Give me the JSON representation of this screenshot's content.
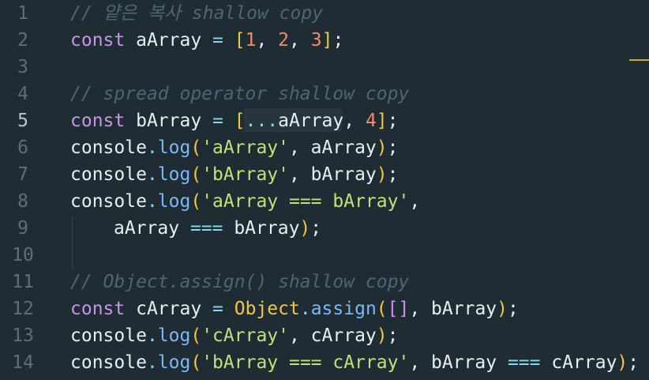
{
  "editor": {
    "active_line": 5,
    "lines": [
      {
        "no": "1",
        "tokens": [
          {
            "t": "// 얕은 복사 shallow copy",
            "c": "cmt"
          }
        ]
      },
      {
        "no": "2",
        "tokens": [
          {
            "t": "const",
            "c": "kw"
          },
          {
            "t": " aArray ",
            "c": "plain"
          },
          {
            "t": "=",
            "c": "op"
          },
          {
            "t": " ",
            "c": "plain"
          },
          {
            "t": "[",
            "c": "br"
          },
          {
            "t": "1",
            "c": "num"
          },
          {
            "t": ", ",
            "c": "plain"
          },
          {
            "t": "2",
            "c": "num"
          },
          {
            "t": ", ",
            "c": "plain"
          },
          {
            "t": "3",
            "c": "num"
          },
          {
            "t": "]",
            "c": "br"
          },
          {
            "t": ";",
            "c": "plain"
          }
        ]
      },
      {
        "no": "3",
        "tokens": []
      },
      {
        "no": "4",
        "tokens": [
          {
            "t": "// spread operator shallow copy",
            "c": "cmt"
          }
        ]
      },
      {
        "no": "5",
        "tokens": [
          {
            "t": "const",
            "c": "kw"
          },
          {
            "t": " bArray ",
            "c": "plain"
          },
          {
            "t": "=",
            "c": "op"
          },
          {
            "t": " ",
            "c": "plain"
          },
          {
            "t": "[",
            "c": "br"
          },
          {
            "t": "...",
            "c": "op"
          },
          {
            "t": "aArray, ",
            "c": "plain"
          },
          {
            "t": "4",
            "c": "num"
          },
          {
            "t": "]",
            "c": "br"
          },
          {
            "t": ";",
            "c": "plain"
          }
        ]
      },
      {
        "no": "6",
        "tokens": [
          {
            "t": "console",
            "c": "plain"
          },
          {
            "t": ".",
            "c": "op"
          },
          {
            "t": "log",
            "c": "fn"
          },
          {
            "t": "(",
            "c": "br"
          },
          {
            "t": "'aArray'",
            "c": "str"
          },
          {
            "t": ", aArray",
            "c": "plain"
          },
          {
            "t": ")",
            "c": "br"
          },
          {
            "t": ";",
            "c": "plain"
          }
        ]
      },
      {
        "no": "7",
        "tokens": [
          {
            "t": "console",
            "c": "plain"
          },
          {
            "t": ".",
            "c": "op"
          },
          {
            "t": "log",
            "c": "fn"
          },
          {
            "t": "(",
            "c": "br"
          },
          {
            "t": "'bArray'",
            "c": "str"
          },
          {
            "t": ", bArray",
            "c": "plain"
          },
          {
            "t": ")",
            "c": "br"
          },
          {
            "t": ";",
            "c": "plain"
          }
        ]
      },
      {
        "no": "8",
        "tokens": [
          {
            "t": "console",
            "c": "plain"
          },
          {
            "t": ".",
            "c": "op"
          },
          {
            "t": "log",
            "c": "fn"
          },
          {
            "t": "(",
            "c": "br"
          },
          {
            "t": "'aArray === bArray'",
            "c": "str"
          },
          {
            "t": ",",
            "c": "plain"
          }
        ]
      },
      {
        "no": "9",
        "indent": true,
        "tokens": [
          {
            "t": "aArray ",
            "c": "plain"
          },
          {
            "t": "===",
            "c": "op"
          },
          {
            "t": " bArray",
            "c": "plain"
          },
          {
            "t": ")",
            "c": "br"
          },
          {
            "t": ";",
            "c": "plain"
          }
        ]
      },
      {
        "no": "10",
        "tokens": []
      },
      {
        "no": "11",
        "tokens": [
          {
            "t": "// Object.assign() shallow copy",
            "c": "cmt"
          }
        ]
      },
      {
        "no": "12",
        "tokens": [
          {
            "t": "const",
            "c": "kw"
          },
          {
            "t": " cArray ",
            "c": "plain"
          },
          {
            "t": "=",
            "c": "op"
          },
          {
            "t": " ",
            "c": "plain"
          },
          {
            "t": "Object",
            "c": "br"
          },
          {
            "t": ".",
            "c": "op"
          },
          {
            "t": "assign",
            "c": "fn"
          },
          {
            "t": "(",
            "c": "br"
          },
          {
            "t": "[]",
            "c": "kw"
          },
          {
            "t": ", bArray",
            "c": "plain"
          },
          {
            "t": ")",
            "c": "br"
          },
          {
            "t": ";",
            "c": "plain"
          }
        ]
      },
      {
        "no": "13",
        "tokens": [
          {
            "t": "console",
            "c": "plain"
          },
          {
            "t": ".",
            "c": "op"
          },
          {
            "t": "log",
            "c": "fn"
          },
          {
            "t": "(",
            "c": "br"
          },
          {
            "t": "'cArray'",
            "c": "str"
          },
          {
            "t": ", cArray",
            "c": "plain"
          },
          {
            "t": ")",
            "c": "br"
          },
          {
            "t": ";",
            "c": "plain"
          }
        ]
      },
      {
        "no": "14",
        "tokens": [
          {
            "t": "console",
            "c": "plain"
          },
          {
            "t": ".",
            "c": "op"
          },
          {
            "t": "log",
            "c": "fn"
          },
          {
            "t": "(",
            "c": "br"
          },
          {
            "t": "'bArray === cArray'",
            "c": "str"
          },
          {
            "t": ", bArray ",
            "c": "plain"
          },
          {
            "t": "===",
            "c": "op"
          },
          {
            "t": " cArray",
            "c": "plain"
          },
          {
            "t": ")",
            "c": "br"
          },
          {
            "t": ";",
            "c": "plain"
          }
        ]
      }
    ]
  },
  "colors": {
    "background": "#1f2c33",
    "keyword": "#c794e8",
    "number": "#f48a6a",
    "bracket": "#f3c640",
    "function": "#7cb8f5",
    "string": "#c5e07a",
    "operator": "#89d8f0",
    "comment": "#4f6570"
  }
}
